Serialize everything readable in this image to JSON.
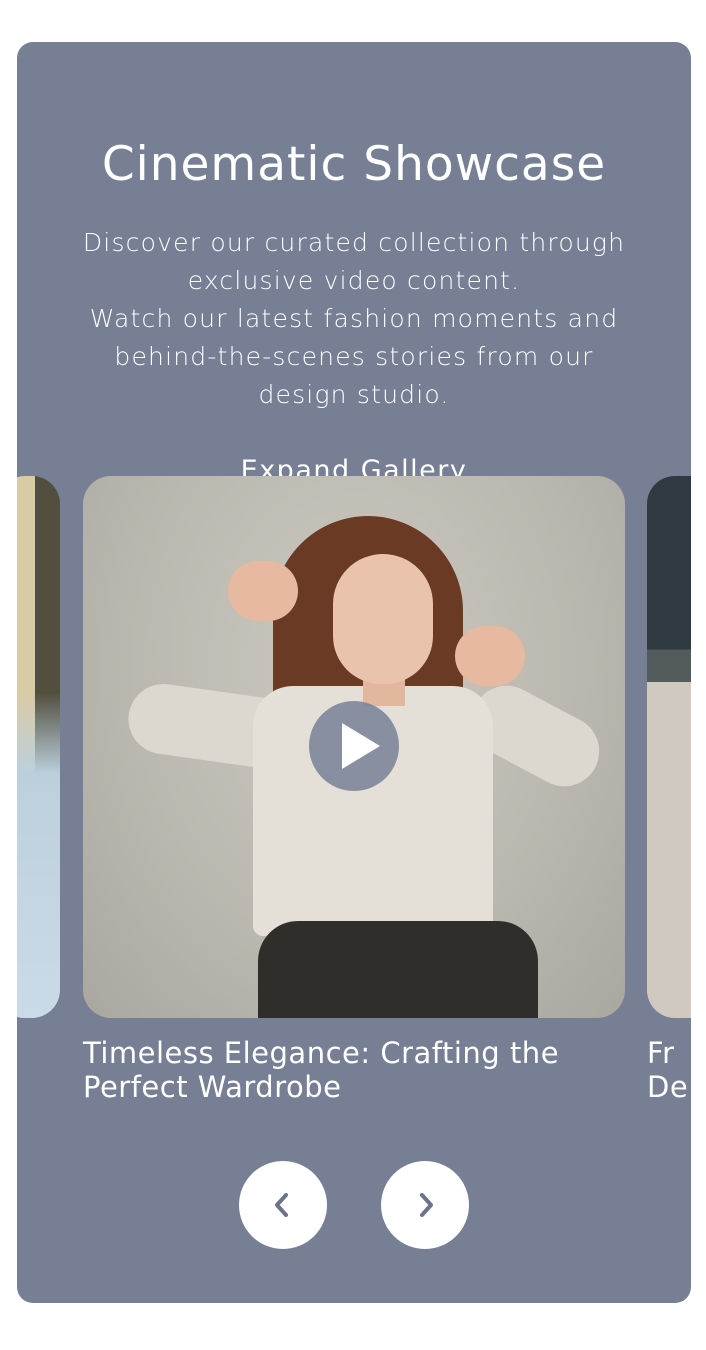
{
  "section": {
    "title": "Cinematic Showcase",
    "description_lines": [
      "Discover our curated collection through exclusive video content.",
      "Watch our latest fashion moments and behind-the-scenes stories from our design studio."
    ],
    "expand_label": "Expand Gallery"
  },
  "carousel": {
    "slides": [
      {
        "caption": "",
        "image": "blurred-street-photo"
      },
      {
        "caption": "Timeless Elegance: Crafting the Perfect Wardrobe",
        "image": "woman-polka-dot-blouse-photo"
      },
      {
        "caption": "Fr\nDe",
        "image": "gravel-path-photo"
      }
    ],
    "play_icon": "play-icon",
    "prev_icon": "chevron-left-icon",
    "next_icon": "chevron-right-icon"
  },
  "colors": {
    "card_bg": "#767f93",
    "text": "#ffffff",
    "button_bg": "#ffffff",
    "button_icon": "#6b7488"
  }
}
